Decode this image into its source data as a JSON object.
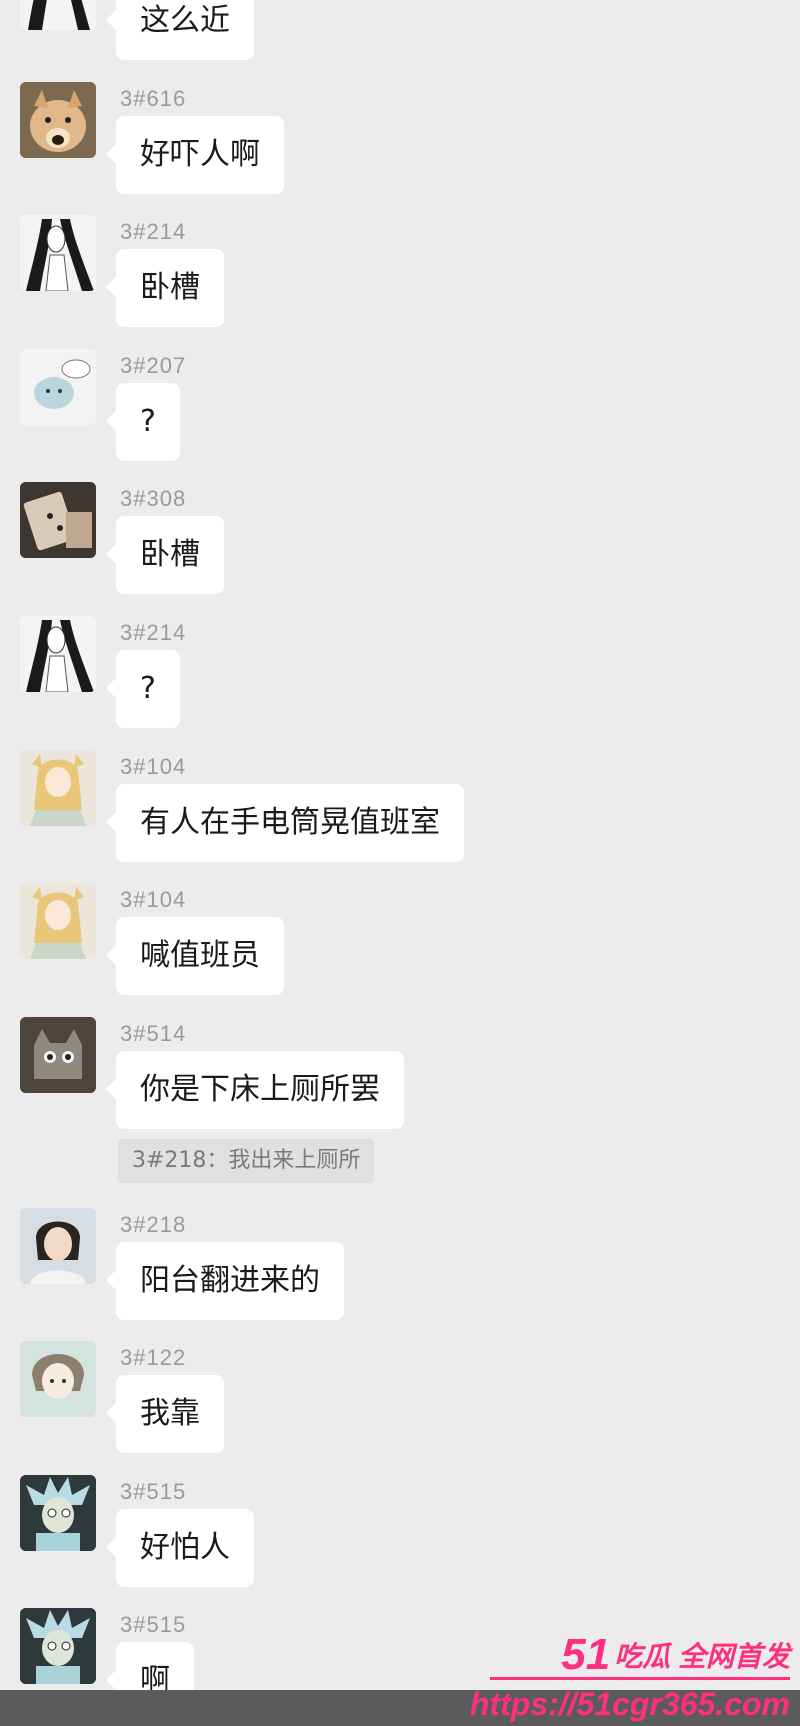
{
  "messages": [
    {
      "id": "",
      "text": "这么近",
      "avatar": "sketch-woman-avatar"
    },
    {
      "id": "3#616",
      "text": "好吓人啊",
      "avatar": "dog-avatar"
    },
    {
      "id": "3#214",
      "text": "卧槽",
      "avatar": "sketch-woman-avatar"
    },
    {
      "id": "3#207",
      "text": "?",
      "avatar": "cartoon-cat-avatar"
    },
    {
      "id": "3#308",
      "text": "卧槽",
      "avatar": "photo-avatar"
    },
    {
      "id": "3#214",
      "text": "?",
      "avatar": "sketch-woman-avatar"
    },
    {
      "id": "3#104",
      "text": "有人在手电筒晃值班室",
      "avatar": "anime-girl-avatar"
    },
    {
      "id": "3#104",
      "text": "喊值班员",
      "avatar": "anime-girl-avatar"
    },
    {
      "id": "3#514",
      "text": "你是下床上厕所罢",
      "avatar": "cat-toy-avatar",
      "quote": "3#218：我出来上厕所"
    },
    {
      "id": "3#218",
      "text": "阳台翻进来的",
      "avatar": "person-avatar"
    },
    {
      "id": "3#122",
      "text": "我靠",
      "avatar": "anime-boy-avatar"
    },
    {
      "id": "3#515",
      "text": "好怕人",
      "avatar": "rick-avatar"
    },
    {
      "id": "3#515",
      "text": "啊",
      "avatar": "rick-avatar"
    }
  ],
  "watermark": {
    "brand_number": "51",
    "brand_text": "吃瓜 全网首发",
    "url": "https://51cgr365.com"
  },
  "colors": {
    "background": "#ececec",
    "bubble": "#ffffff",
    "watermark": "#ff2f7f"
  }
}
